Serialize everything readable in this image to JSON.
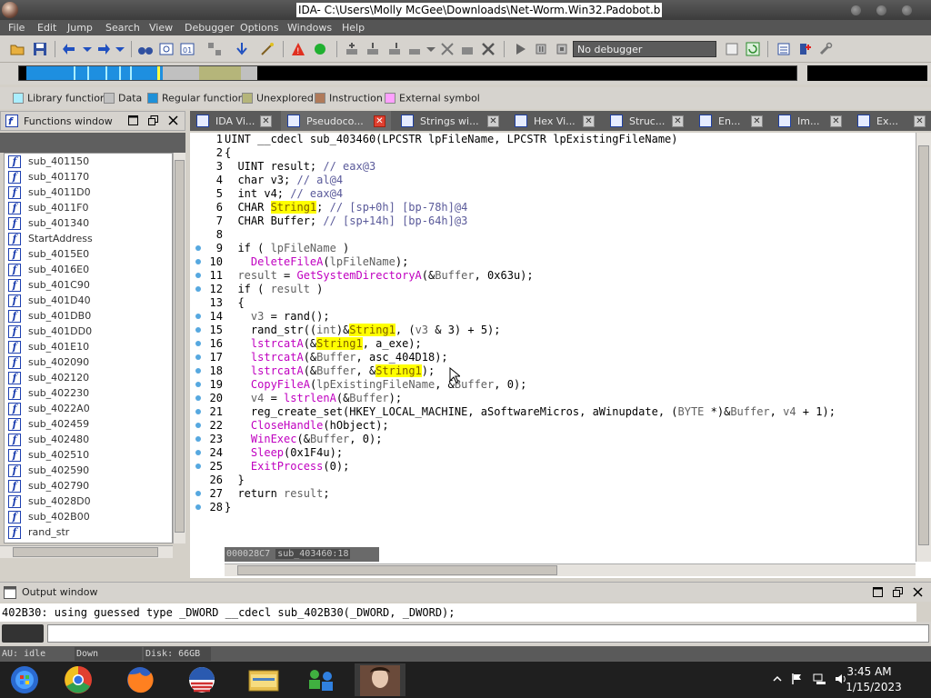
{
  "window": {
    "title": "IDA- C:\\Users\\Molly McGee\\Downloads\\Net-Worm.Win32.Padobot.b"
  },
  "menu": [
    "File",
    "Edit",
    "Jump",
    "Search",
    "View",
    "Debugger",
    "Options",
    "Windows",
    "Help"
  ],
  "toolbar": {
    "debugger_select": "No debugger"
  },
  "legend": [
    {
      "label": "Library function",
      "color": "#aaeeff"
    },
    {
      "label": "Data",
      "color": "#c0c0c0"
    },
    {
      "label": "Regular function",
      "color": "#1e90d8"
    },
    {
      "label": "Unexplored",
      "color": "#b5b57a"
    },
    {
      "label": "Instruction",
      "color": "#b07a5a"
    },
    {
      "label": "External symbol",
      "color": "#ffa0ff"
    }
  ],
  "functions_window": {
    "title": "Functions window",
    "items": [
      "sub_401150",
      "sub_401170",
      "sub_4011D0",
      "sub_4011F0",
      "sub_401340",
      "StartAddress",
      "sub_4015E0",
      "sub_4016E0",
      "sub_401C90",
      "sub_401D40",
      "sub_401DB0",
      "sub_401DD0",
      "sub_401E10",
      "sub_402090",
      "sub_402120",
      "sub_402230",
      "sub_4022A0",
      "sub_402459",
      "sub_402480",
      "sub_402510",
      "sub_402590",
      "sub_402790",
      "sub_4028D0",
      "sub_402B00",
      "rand_str"
    ]
  },
  "tabs": [
    {
      "label": "IDA Vi...",
      "active": false
    },
    {
      "label": "Pseudoco...",
      "active": true
    },
    {
      "label": "Strings wi...",
      "active": false
    },
    {
      "label": "Hex Vi...",
      "active": false
    },
    {
      "label": "Struc...",
      "active": false
    },
    {
      "label": "En...",
      "active": false
    },
    {
      "label": "Im...",
      "active": false
    },
    {
      "label": "Ex...",
      "active": false
    }
  ],
  "code": {
    "line_numbers": [
      "1",
      "2",
      "3",
      "4",
      "5",
      "6",
      "7",
      "8",
      "9",
      "10",
      "11",
      "12",
      "13",
      "14",
      "15",
      "16",
      "17",
      "18",
      "19",
      "20",
      "21",
      "22",
      "23",
      "24",
      "25",
      "26",
      "27",
      "28"
    ],
    "status_offset": "000028C7",
    "status_func": "sub_403460:18"
  },
  "output_window": {
    "title": "Output window",
    "text": "402B30: using guessed type _DWORD __cdecl sub_402B30(_DWORD, _DWORD);"
  },
  "status": {
    "au": "AU:  idle",
    "direction": "Down",
    "disk": "Disk: 66GB"
  },
  "taskbar": {
    "time": "3:45 AM",
    "date": "1/15/2023"
  }
}
